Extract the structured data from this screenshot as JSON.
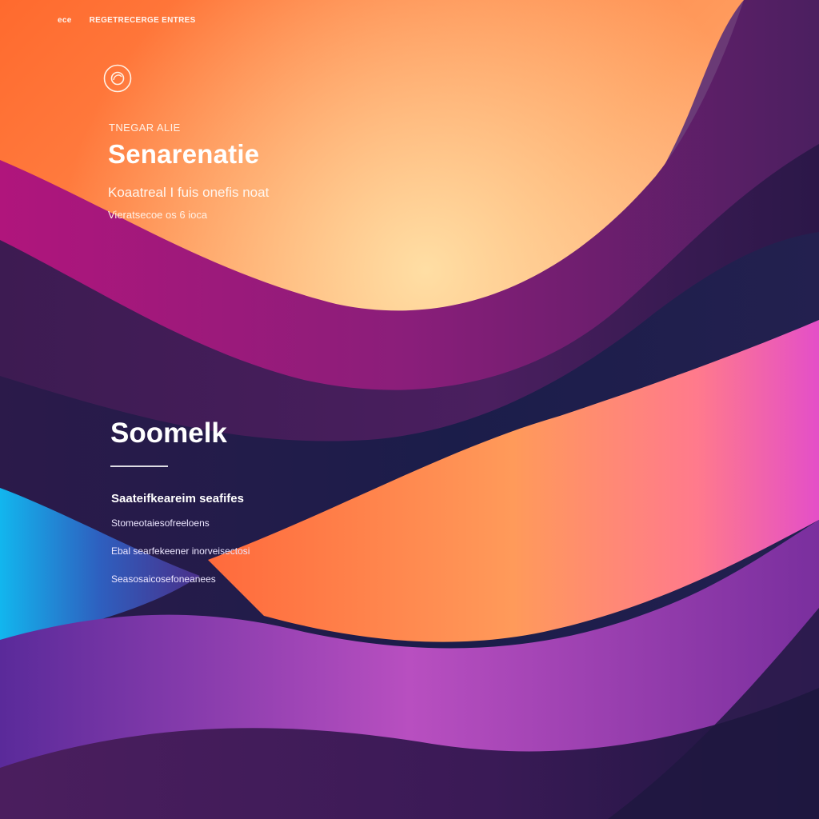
{
  "header": {
    "nav": [
      "ece",
      "REGETRECERGE ENTRES"
    ]
  },
  "hero": {
    "eyebrow": "TNEGAR ALIE",
    "title": "Senarenatie",
    "line1": "Koaatreal I fuis onefis noat",
    "line2": "Vieratsecoe os 6 ioca"
  },
  "section": {
    "title": "Soomelk",
    "subhead": "Saateifkeareim seafifes",
    "items": [
      "Stomeotaiesofreeloens",
      "Ebal searfekeener inorveisectosi",
      "Seasosaicosefoneanees"
    ]
  },
  "colors": {
    "orange": "#ff7a3c",
    "peach": "#ffd49a",
    "lavender": "#d9b8ff",
    "purple": "#4a1f5f",
    "navy": "#1b1d4a",
    "magenta": "#c21a8a",
    "cyan": "#1aa0e0",
    "pink": "#e44fc8"
  },
  "icons": {
    "logo": "circle-logo-icon"
  }
}
